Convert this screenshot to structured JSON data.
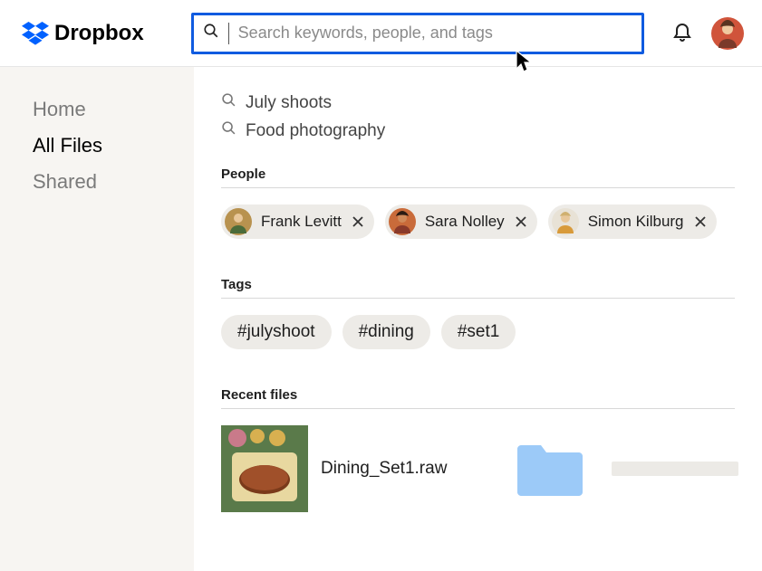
{
  "brand": {
    "name": "Dropbox"
  },
  "header": {
    "search_placeholder": "Search keywords, people, and tags"
  },
  "sidebar": {
    "items": [
      {
        "label": "Home",
        "active": false
      },
      {
        "label": "All Files",
        "active": true
      },
      {
        "label": "Shared",
        "active": false
      }
    ]
  },
  "suggestions": [
    {
      "label": "July shoots"
    },
    {
      "label": "Food photography"
    }
  ],
  "sections": {
    "people_header": "People",
    "tags_header": "Tags",
    "recent_header": "Recent files"
  },
  "people": [
    {
      "name": "Frank Levitt"
    },
    {
      "name": "Sara Nolley"
    },
    {
      "name": "Simon Kilburg"
    }
  ],
  "tags": [
    {
      "label": "#julyshoot"
    },
    {
      "label": "#dining"
    },
    {
      "label": "#set1"
    }
  ],
  "recent_files": [
    {
      "name": "Dining_Set1.raw",
      "type": "image"
    },
    {
      "name": "",
      "type": "folder"
    }
  ],
  "colors": {
    "accent": "#0f5be0",
    "folder": "#9ccaf8",
    "chip_bg": "#edebe7",
    "sidebar_bg": "#f7f5f2"
  }
}
